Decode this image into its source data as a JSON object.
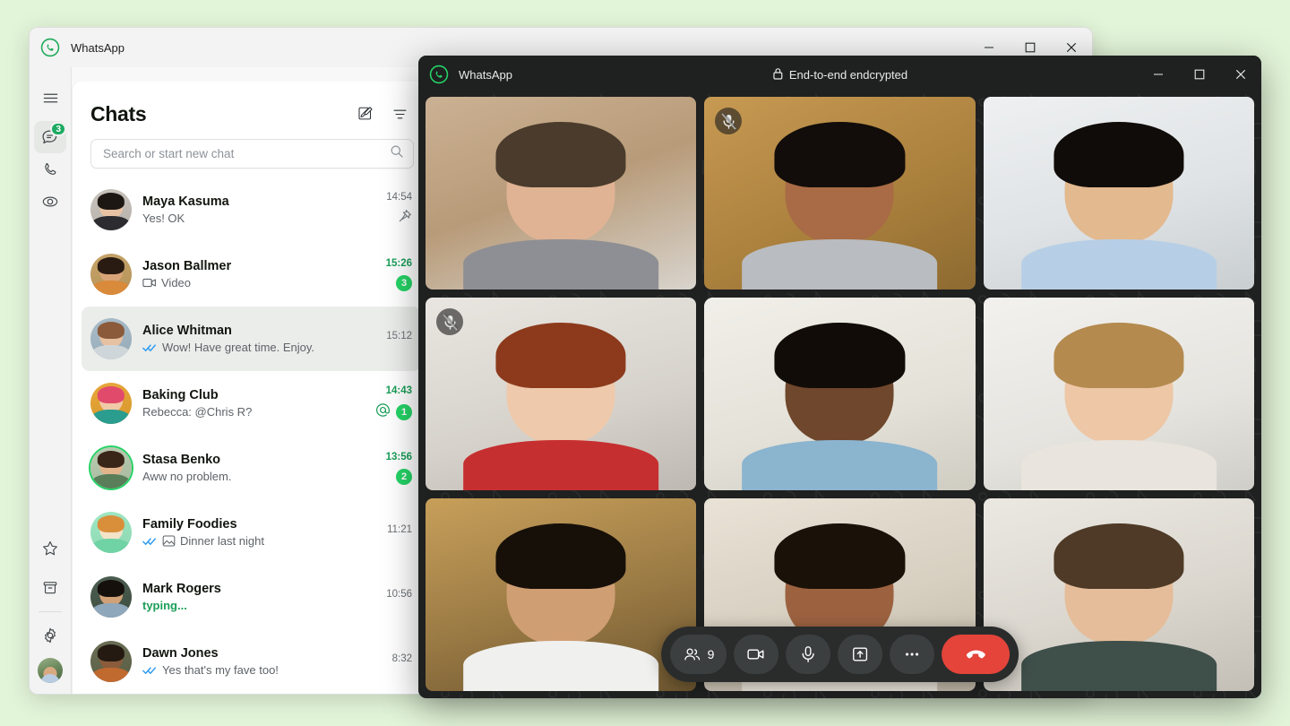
{
  "theme": {
    "page_bg": "#E3F5D9",
    "accent_green": "#1DAA61",
    "badge_green": "#25D366",
    "tick_blue": "#2F9BF0",
    "end_call_red": "#E4443A",
    "call_bg": "#1F2020"
  },
  "main_window": {
    "title": "WhatsApp",
    "logo_icon": "whatsapp-logo-icon",
    "window_controls": {
      "minimize": "minimize-icon",
      "maximize": "maximize-icon",
      "close": "close-icon"
    },
    "nav_rail": {
      "items": [
        {
          "name": "menu",
          "icon": "hamburger-menu-icon",
          "badge": "",
          "active": false
        },
        {
          "name": "chats",
          "icon": "chats-bubble-icon",
          "badge": "3",
          "active": true
        },
        {
          "name": "calls",
          "icon": "phone-icon",
          "badge": "",
          "active": false
        },
        {
          "name": "status",
          "icon": "status-circle-icon",
          "badge": "",
          "active": false
        }
      ],
      "bottom_items": [
        {
          "name": "starred",
          "icon": "star-icon",
          "badge": ""
        },
        {
          "name": "archived",
          "icon": "archive-box-icon",
          "badge": ""
        },
        {
          "name": "settings",
          "icon": "gear-icon",
          "badge": ""
        }
      ],
      "profile": {
        "name": "profile-avatar",
        "icon": "user-avatar"
      }
    },
    "chat_panel": {
      "title": "Chats",
      "new_chat_icon": "compose-new-chat-icon",
      "filter_icon": "filter-icon",
      "search": {
        "placeholder": "Search or start new chat",
        "value": "",
        "icon": "search-icon"
      },
      "chats": [
        {
          "name": "Maya Kasuma",
          "message": "Yes! OK",
          "time": "14:54",
          "time_unread": false,
          "unread": "",
          "pinned": true,
          "ticks": false,
          "mention": false,
          "typing": false,
          "attachment": "",
          "selected": false,
          "ring": false
        },
        {
          "name": "Jason Ballmer",
          "message": "Video",
          "time": "15:26",
          "time_unread": true,
          "unread": "3",
          "pinned": false,
          "ticks": false,
          "mention": false,
          "typing": false,
          "attachment": "video-camera-icon",
          "selected": false,
          "ring": false
        },
        {
          "name": "Alice Whitman",
          "message": "Wow! Have great time. Enjoy.",
          "time": "15:12",
          "time_unread": false,
          "unread": "",
          "pinned": false,
          "ticks": true,
          "mention": false,
          "typing": false,
          "attachment": "",
          "selected": true,
          "ring": false
        },
        {
          "name": "Baking Club",
          "message": "Rebecca: @Chris R?",
          "time": "14:43",
          "time_unread": true,
          "unread": "1",
          "pinned": false,
          "ticks": false,
          "mention": true,
          "typing": false,
          "attachment": "",
          "selected": false,
          "ring": false
        },
        {
          "name": "Stasa Benko",
          "message": "Aww no problem.",
          "time": "13:56",
          "time_unread": true,
          "unread": "2",
          "pinned": false,
          "ticks": false,
          "mention": false,
          "typing": false,
          "attachment": "",
          "selected": false,
          "ring": true
        },
        {
          "name": "Family Foodies",
          "message": "Dinner last night",
          "time": "11:21",
          "time_unread": false,
          "unread": "",
          "pinned": false,
          "ticks": true,
          "mention": false,
          "typing": false,
          "attachment": "image-icon",
          "selected": false,
          "ring": false
        },
        {
          "name": "Mark Rogers",
          "message": "typing...",
          "time": "10:56",
          "time_unread": false,
          "unread": "",
          "pinned": false,
          "ticks": false,
          "mention": false,
          "typing": true,
          "attachment": "",
          "selected": false,
          "ring": false
        },
        {
          "name": "Dawn Jones",
          "message": "Yes that's my fave too!",
          "time": "8:32",
          "time_unread": false,
          "unread": "",
          "pinned": false,
          "ticks": true,
          "mention": false,
          "typing": false,
          "attachment": "",
          "selected": false,
          "ring": false
        }
      ]
    }
  },
  "call_window": {
    "title": "WhatsApp",
    "logo_icon": "whatsapp-logo-icon",
    "encryption_label": "End-to-end endcrypted",
    "lock_icon": "lock-icon",
    "window_controls": {
      "minimize": "minimize-icon",
      "maximize": "maximize-icon",
      "close": "close-icon"
    },
    "participants": [
      {
        "id": "p1",
        "muted": false,
        "speaking": false
      },
      {
        "id": "p2",
        "muted": true,
        "speaking": false
      },
      {
        "id": "p3",
        "muted": false,
        "speaking": false
      },
      {
        "id": "p4",
        "muted": true,
        "speaking": false
      },
      {
        "id": "p5",
        "muted": false,
        "speaking": true
      },
      {
        "id": "p6",
        "muted": false,
        "speaking": false
      },
      {
        "id": "p7",
        "muted": false,
        "speaking": false
      },
      {
        "id": "p8",
        "muted": false,
        "speaking": false
      },
      {
        "id": "p9",
        "muted": false,
        "speaking": false
      }
    ],
    "controls": {
      "participants_count": "9",
      "participants_icon": "people-icon",
      "camera_icon": "video-camera-icon",
      "mic_icon": "microphone-icon",
      "share_screen_icon": "share-screen-icon",
      "more_icon": "more-options-icon",
      "end_call_icon": "end-call-icon"
    }
  }
}
